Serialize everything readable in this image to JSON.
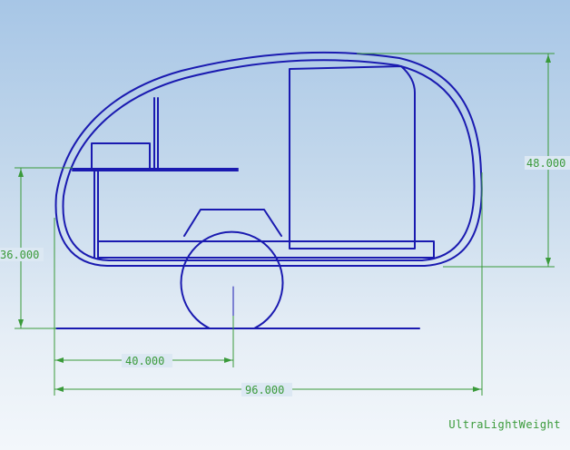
{
  "colors": {
    "outline": "#1a1ab0",
    "dimension": "#3a9a3a",
    "background_top": "#a7c6e6",
    "background_bottom": "#f3f7fb"
  },
  "dimensions": {
    "height_total": "48.000",
    "height_floor": "36.000",
    "axle_offset": "40.000",
    "length_total": "96.000"
  },
  "brand": "UltraLightWeight"
}
